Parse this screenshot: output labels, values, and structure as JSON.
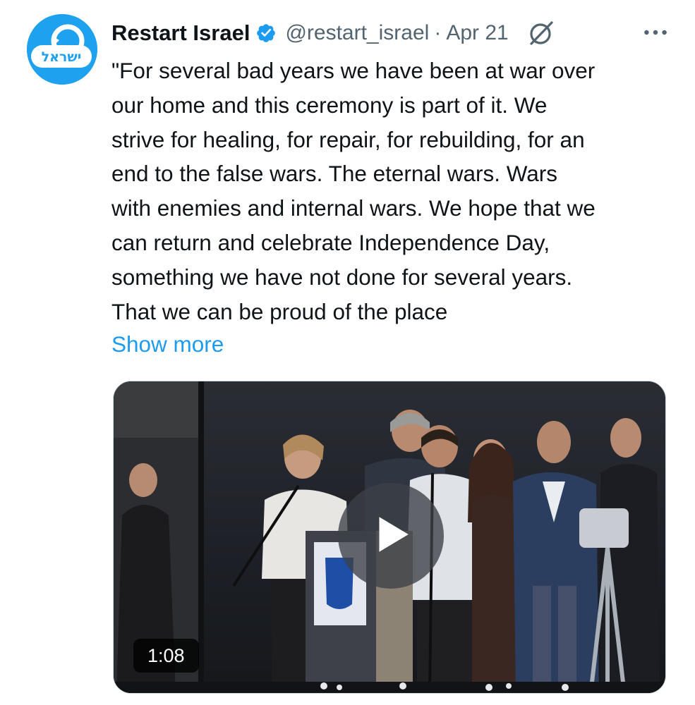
{
  "author": {
    "display_name": "Restart Israel",
    "handle": "@restart_israel",
    "avatar_text": "ישראל",
    "verified": true
  },
  "meta": {
    "separator": "·",
    "date": "Apr 21"
  },
  "body": {
    "lines": [
      "\"For several bad years we have been at war over",
      "our home and this ceremony is part of it. We",
      "strive for healing, for repair, for rebuilding, for an",
      "end to the false wars. The eternal wars. Wars",
      "with enemies and internal wars. We hope that we",
      "can return and celebrate Independence Day,",
      "something we have not done for several years.",
      "That we can be proud of the place"
    ],
    "show_more": "Show more"
  },
  "media": {
    "type": "video",
    "duration": "1:08"
  },
  "icons": {
    "verified": "verified-badge-icon",
    "grok": "grok-icon",
    "more": "more-icon",
    "play": "play-icon"
  },
  "colors": {
    "link": "#1d9bf0",
    "secondary": "#536471",
    "brand": "#1da1f2"
  }
}
